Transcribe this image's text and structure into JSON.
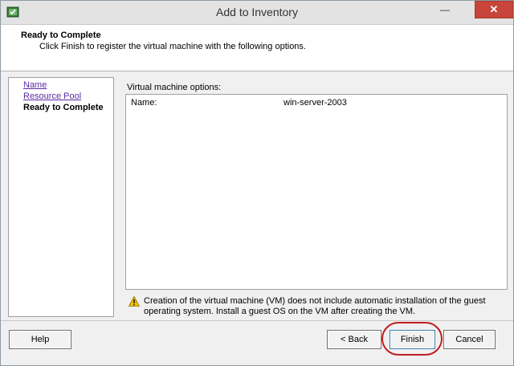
{
  "window": {
    "title": "Add to Inventory",
    "minimize_symbol": "—",
    "close_symbol": "✕"
  },
  "header": {
    "title": "Ready to Complete",
    "subtitle": "Click Finish to register the virtual machine with the following options."
  },
  "nav": {
    "items": [
      {
        "label": "Name",
        "state": "link"
      },
      {
        "label": "Resource Pool",
        "state": "link"
      },
      {
        "label": "Ready to Complete",
        "state": "current"
      }
    ]
  },
  "content": {
    "label": "Virtual machine options:",
    "options": [
      {
        "name": "Name:",
        "value": "win-server-2003"
      }
    ],
    "warning": "Creation of the virtual machine (VM) does not include automatic installation of the guest operating system. Install a guest OS on the VM after creating the VM."
  },
  "buttons": {
    "help": "Help",
    "back": "< Back",
    "finish": "Finish",
    "cancel": "Cancel"
  },
  "colors": {
    "close_button": "#c7453a",
    "link": "#5b2aa6",
    "highlight_circle": "#c11c1c",
    "warning_icon": "#f2c200"
  }
}
